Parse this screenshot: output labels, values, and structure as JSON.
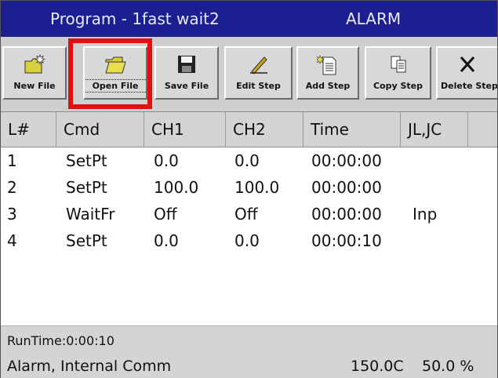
{
  "titlebar": {
    "title": "Program - 1fast wait2",
    "status": "ALARM"
  },
  "toolbar": {
    "buttons": [
      {
        "label": "New File"
      },
      {
        "label": "Open File"
      },
      {
        "label": "Save File"
      },
      {
        "label": "Edit Step"
      },
      {
        "label": "Add Step"
      },
      {
        "label": "Copy Step"
      },
      {
        "label": "Delete Step"
      }
    ]
  },
  "table": {
    "columns": [
      "L#",
      "Cmd",
      "CH1",
      "CH2",
      "Time",
      "JL,JC"
    ],
    "rows": [
      [
        "1",
        "SetPt",
        "0.0",
        "0.0",
        "00:00:00",
        ""
      ],
      [
        "2",
        "SetPt",
        "100.0",
        "100.0",
        "00:00:00",
        ""
      ],
      [
        "3",
        "WaitFr",
        "Off",
        "Off",
        "00:00:00",
        "Inp"
      ],
      [
        "4",
        "SetPt",
        "0.0",
        "0.0",
        "00:00:10",
        ""
      ]
    ]
  },
  "statusbar": {
    "runtime": "RunTime:0:00:10",
    "alarm": "Alarm, Internal Comm",
    "temperature": "150.0C",
    "output": "50.0 %"
  },
  "colors": {
    "titlebar": "#1b1f8f",
    "highlight": "#e01010",
    "panel": "#d4d4d4"
  },
  "icons": [
    "new-file-icon",
    "open-folder-icon",
    "floppy-disk-icon",
    "pencil-icon",
    "add-document-icon",
    "copy-icon",
    "delete-x-icon"
  ]
}
